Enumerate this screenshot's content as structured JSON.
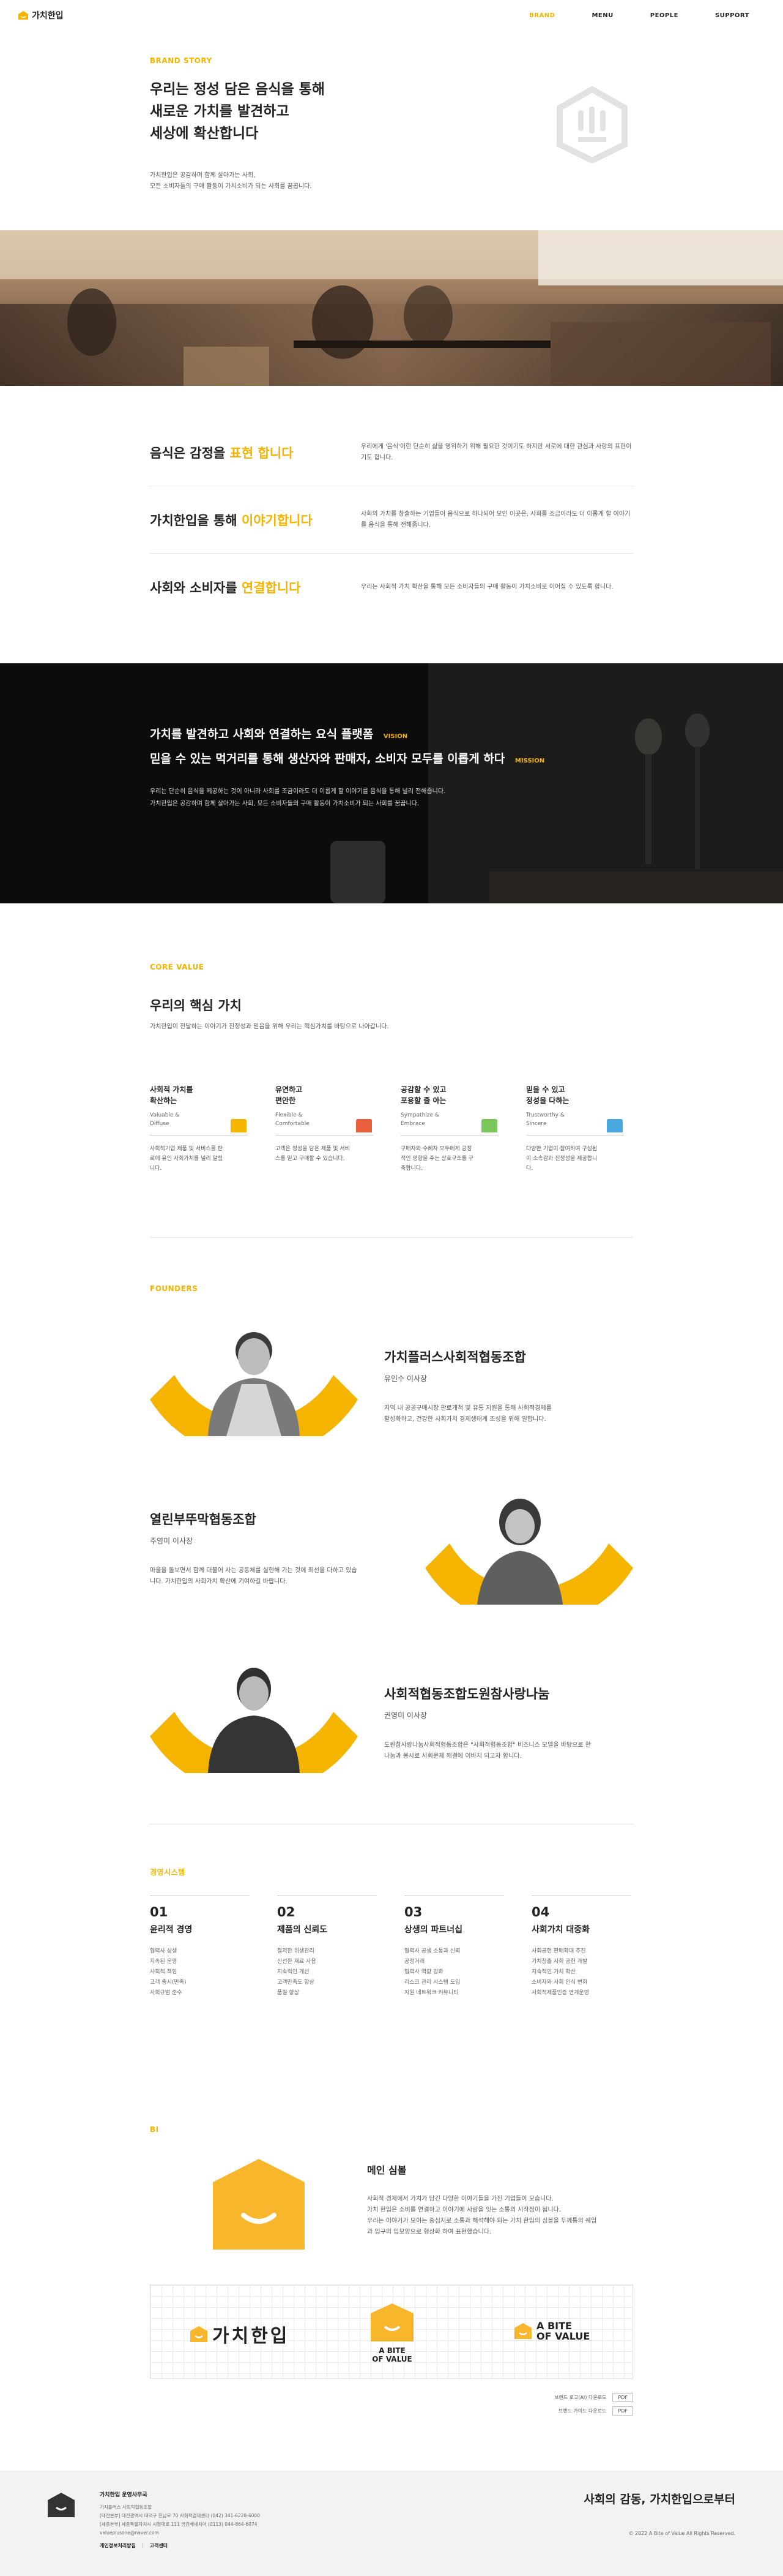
{
  "header": {
    "logo_text": "가치한입",
    "nav": [
      "BRAND",
      "MENU",
      "PEOPLE",
      "SUPPORT"
    ]
  },
  "brand_story": {
    "eyebrow": "BRAND STORY",
    "title_lines": [
      "우리는 정성 담은 음식을 통해",
      "새로운 가치를 발견하고",
      "세상에 확산합니다"
    ],
    "desc_lines": [
      "가치한입은 공감하며 함께 살아가는 사회,",
      "모든 소비자들의 구매 활동이 가치소비가 되는 사회를 꿈꿉니다."
    ]
  },
  "values_rows": [
    {
      "pre": "음식은 감정을 ",
      "hl": "표현 합니다",
      "desc": "우리에게 '음식'이란 단순히 삶을 영위하기 위해 필요한 것이기도 하지만 서로에 대한 관심과 사랑의 표현이기도 합니다."
    },
    {
      "pre": "가치한입을 통해 ",
      "hl": "이야기합니다",
      "desc": "사회의 가치를 창출하는 기업들이 음식으로 하나되어 모인 이곳은, 사회를 조금이라도 더 이롭게 할 이야기를 음식을 통해 전해줍니다."
    },
    {
      "pre": "사회와 소비자를 ",
      "hl": "연결합니다",
      "desc": "우리는 사회적 가치 확산을 통해 모든 소비자들의 구매 활동이 가치소비로 이어질 수 있도록 합니다."
    }
  ],
  "vision": {
    "line1": "가치를 발견하고 사회와 연결하는 요식 플랫폼",
    "tag1": "VISION",
    "line2": "믿을 수 있는 먹거리를 통해 생산자와 판매자, 소비자 모두를 이롭게 하다",
    "tag2": "MISSION",
    "desc1": "우리는 단순히 음식을 제공하는 것이 아니라 사회를 조금이라도 더 이롭게 할 이야기를 음식을 통해 널리 전해줍니다.",
    "desc2": "가치한입은 공감하며 함께 살아가는 사회, 모든 소비자들의 구매 활동이 가치소비가 되는 사회를 꿈꿉니다."
  },
  "core_value": {
    "eyebrow": "CORE VALUE",
    "title": "우리의 핵심 가치",
    "desc": "가치한입이 전달하는 이야기가 진정성과 믿음을 위해 우리는 핵심가치를 바탕으로 나아갑니다.",
    "items": [
      {
        "title1": "사회적 가치를",
        "title2": "확산하는",
        "en1": "Valuable &",
        "en2": "Diffuse",
        "color": "#f5b400",
        "d1": "사회적기업 제품 및 서비스를 판",
        "d2": "로에 유인 사회가치를 널리 알림",
        "d3": "니다."
      },
      {
        "title1": "유연하고",
        "title2": "편안한",
        "en1": "Flexible &",
        "en2": "Comfortable",
        "color": "#e8603c",
        "d1": "고객은 정성을 담은 제품 및 서비",
        "d2": "스를 믿고 구매할 수 있습니다.",
        "d3": ""
      },
      {
        "title1": "공감할 수 있고",
        "title2": "포용할 줄 아는",
        "en1": "Sympathize &",
        "en2": "Embrace",
        "color": "#7ac75a",
        "d1": "구매자와 수혜자 모두에게 긍정",
        "d2": "적인 영향을 주는 상호구조를 구",
        "d3": "축합니다."
      },
      {
        "title1": "믿을 수 있고",
        "title2": "정성을 다하는",
        "en1": "Trustworthy &",
        "en2": "Sincere",
        "color": "#4aa8e0",
        "d1": "다양한 기업이 참여하여 구성된",
        "d2": "이 소속감과 진정성을 제공합니",
        "d3": "다."
      }
    ]
  },
  "founders": {
    "eyebrow": "FOUNDERS",
    "people": [
      {
        "org": "가치플러스사회적협동조합",
        "role": "유인수 이사장",
        "d1": "지역 내 공공구매시장 판로개척 및 유통 지원을 통해 사회적경제를",
        "d2": "활성화하고, 건강한 사회가치 경제생태계 조성을 위해 일합니다."
      },
      {
        "org": "열린부뚜막협동조합",
        "role": "주영미 이사장",
        "d1": "마을을 돌보면서 함께 더불어 사는 공동체를 실현해 가는 것에 최선을 다하고 있습",
        "d2": "니다. 가치한입의 사회가치 확산에 기여하길 바랍니다."
      },
      {
        "org": "사회적협동조합도원참사랑나눔",
        "role": "권영미 이사장",
        "d1": "도원참사랑나눔사회적협동조합은 \"사회적협동조합\" 비즈니스 모델을 바탕으로 한",
        "d2": "나눔과 봉사로 사회문제 해결에 이바지 되고자 합니다."
      }
    ]
  },
  "philosophy": {
    "eyebrow": "경영시스템",
    "items": [
      {
        "num": "01",
        "title": "윤리적 경영",
        "lines": [
          "협력사 상생",
          "지속된 운영",
          "사회적 책임",
          "고객 중시(만족)",
          "사회규범 준수"
        ]
      },
      {
        "num": "02",
        "title": "제품의 신뢰도",
        "lines": [
          "철저한 위생관리",
          "신선한 재료 사용",
          "지속적인 개선",
          "고객만족도 향상",
          "품질 향상"
        ]
      },
      {
        "num": "03",
        "title": "상생의 파트너십",
        "lines": [
          "협력사 공생 소통과 신뢰",
          "공정거래",
          "협력사 역량 강화",
          "리스크 관리 시스템 도입",
          "지원 네트워크 커뮤니티"
        ]
      },
      {
        "num": "04",
        "title": "사회가치 대중화",
        "lines": [
          "사회공헌 판매확대 추진",
          "가치창출 사회 공헌 개발",
          "지속적인 가치 확산",
          "소비자와 사회 인식 변화",
          "사회적제품인증 연계운영"
        ]
      }
    ]
  },
  "bi": {
    "eyebrow": "BI",
    "title": "메인 심볼",
    "lines": [
      "사회적 경제에서 가치가 담긴 다양한 이야기들을 가진 기업들이 모습니다.",
      "가치 한입은 소비를 연결하고 이야기에 사람을 잇는 소통의 시작점이 됩니다.",
      "우리는 이야기가 모이는 중심지로 소통과 해석해야 되는 가치 한입의 심볼을 두께통의 쉐입",
      "과 입구의 입모양으로 형상화 하여 표현했습니다."
    ],
    "logo_ko": "가치한입",
    "logo_en1": "A BITE",
    "logo_en2": "OF VALUE",
    "dl": [
      {
        "label": "브랜드 로고(AI) 다운로드",
        "btn": "PDF"
      },
      {
        "label": "브랜드 가이드 다운로드",
        "btn": "PDF"
      }
    ]
  },
  "footer": {
    "title": "가치한입 운영사무국",
    "lines": [
      "가치플러스 사회적협동조합",
      "[대전본부] 대전광역시 대덕구 한남로 70 사회적경제센터 (042) 341-6228-6000",
      "[세종본부] 세종특별자치시 시청대로 111 금강베네치아 (0113) 044-864-6074",
      "valueplusone@naver.com"
    ],
    "links": [
      "개인정보처리방침",
      "고객센터"
    ],
    "slogan": "사회의 감동, 가치한입으로부터",
    "copyright": "© 2022 A Bite of Value All Rights Reserved."
  }
}
